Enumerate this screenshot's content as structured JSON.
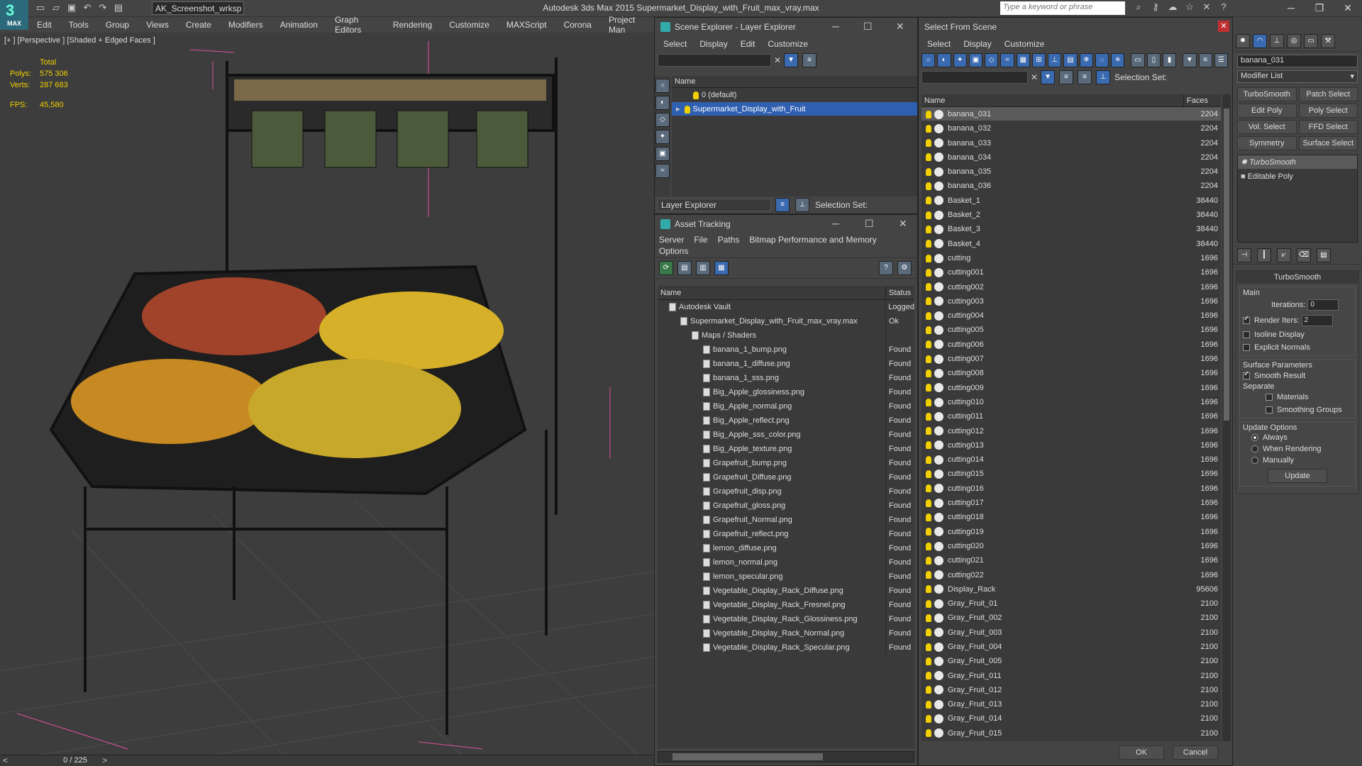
{
  "app": {
    "title": "Autodesk 3ds Max  2015     Supermarket_Display_with_Fruit_max_vray.max",
    "workspace": "AK_Screenshot_wrksp",
    "search_placeholder": "Type a keyword or phrase",
    "logo_text": "MAX"
  },
  "menu": [
    "Edit",
    "Tools",
    "Group",
    "Views",
    "Create",
    "Modifiers",
    "Animation",
    "Graph Editors",
    "Rendering",
    "Customize",
    "MAXScript",
    "Corona",
    "Project Man"
  ],
  "viewport": {
    "label": "[+ ] [Perspective ] [Shaded + Edged Faces ]",
    "stats_total": "Total",
    "polys_label": "Polys:",
    "polys": "575 306",
    "verts_label": "Verts:",
    "verts": "287 683",
    "fps_label": "FPS:",
    "fps": "45,580"
  },
  "timeline": {
    "frame": "0 / 225"
  },
  "scene_explorer": {
    "title": "Scene Explorer - Layer Explorer",
    "menu": [
      "Select",
      "Display",
      "Edit",
      "Customize"
    ],
    "col_name": "Name",
    "rows": [
      "0 (default)",
      "Supermarket_Display_with_Fruit"
    ],
    "footer_mode": "Layer Explorer",
    "selection_set": "Selection Set:"
  },
  "asset_tracking": {
    "title": "Asset Tracking",
    "menu": [
      "Server",
      "File",
      "Paths",
      "Bitmap Performance and Memory"
    ],
    "menu2": "Options",
    "col_name": "Name",
    "col_status": "Status",
    "rows": [
      {
        "name": "Autodesk Vault",
        "status": "Logged",
        "indent": 1
      },
      {
        "name": "Supermarket_Display_with_Fruit_max_vray.max",
        "status": "Ok",
        "indent": 2
      },
      {
        "name": "Maps / Shaders",
        "status": "",
        "indent": 3
      },
      {
        "name": "banana_1_bump.png",
        "status": "Found",
        "indent": 4
      },
      {
        "name": "banana_1_diffuse.png",
        "status": "Found",
        "indent": 4
      },
      {
        "name": "banana_1_sss.png",
        "status": "Found",
        "indent": 4
      },
      {
        "name": "Big_Apple_glossiness.png",
        "status": "Found",
        "indent": 4
      },
      {
        "name": "Big_Apple_normal.png",
        "status": "Found",
        "indent": 4
      },
      {
        "name": "Big_Apple_reflect.png",
        "status": "Found",
        "indent": 4
      },
      {
        "name": "Big_Apple_sss_color.png",
        "status": "Found",
        "indent": 4
      },
      {
        "name": "Big_Apple_texture.png",
        "status": "Found",
        "indent": 4
      },
      {
        "name": "Grapefruit_bump.png",
        "status": "Found",
        "indent": 4
      },
      {
        "name": "Grapefruit_Diffuse.png",
        "status": "Found",
        "indent": 4
      },
      {
        "name": "Grapefruit_disp.png",
        "status": "Found",
        "indent": 4
      },
      {
        "name": "Grapefruit_gloss.png",
        "status": "Found",
        "indent": 4
      },
      {
        "name": "Grapefruit_Normal.png",
        "status": "Found",
        "indent": 4
      },
      {
        "name": "Grapefruit_reflect.png",
        "status": "Found",
        "indent": 4
      },
      {
        "name": "lemon_diffuse.png",
        "status": "Found",
        "indent": 4
      },
      {
        "name": "lemon_normal.png",
        "status": "Found",
        "indent": 4
      },
      {
        "name": "lemon_specular.png",
        "status": "Found",
        "indent": 4
      },
      {
        "name": "Vegetable_Display_Rack_Diffuse.png",
        "status": "Found",
        "indent": 4
      },
      {
        "name": "Vegetable_Display_Rack_Fresnel.png",
        "status": "Found",
        "indent": 4
      },
      {
        "name": "Vegetable_Display_Rack_Glossiness.png",
        "status": "Found",
        "indent": 4
      },
      {
        "name": "Vegetable_Display_Rack_Normal.png",
        "status": "Found",
        "indent": 4
      },
      {
        "name": "Vegetable_Display_Rack_Specular.png",
        "status": "Found",
        "indent": 4
      }
    ]
  },
  "select_from_scene": {
    "title": "Select From Scene",
    "menu": [
      "Select",
      "Display",
      "Customize"
    ],
    "selection_set": "Selection Set:",
    "col_name": "Name",
    "col_faces": "Faces",
    "ok": "OK",
    "cancel": "Cancel",
    "rows": [
      {
        "name": "banana_031",
        "faces": "2204"
      },
      {
        "name": "banana_032",
        "faces": "2204"
      },
      {
        "name": "banana_033",
        "faces": "2204"
      },
      {
        "name": "banana_034",
        "faces": "2204"
      },
      {
        "name": "banana_035",
        "faces": "2204"
      },
      {
        "name": "banana_036",
        "faces": "2204"
      },
      {
        "name": "Basket_1",
        "faces": "38440"
      },
      {
        "name": "Basket_2",
        "faces": "38440"
      },
      {
        "name": "Basket_3",
        "faces": "38440"
      },
      {
        "name": "Basket_4",
        "faces": "38440"
      },
      {
        "name": "cutting",
        "faces": "1696"
      },
      {
        "name": "cutting001",
        "faces": "1696"
      },
      {
        "name": "cutting002",
        "faces": "1696"
      },
      {
        "name": "cutting003",
        "faces": "1696"
      },
      {
        "name": "cutting004",
        "faces": "1696"
      },
      {
        "name": "cutting005",
        "faces": "1696"
      },
      {
        "name": "cutting006",
        "faces": "1696"
      },
      {
        "name": "cutting007",
        "faces": "1696"
      },
      {
        "name": "cutting008",
        "faces": "1696"
      },
      {
        "name": "cutting009",
        "faces": "1696"
      },
      {
        "name": "cutting010",
        "faces": "1696"
      },
      {
        "name": "cutting011",
        "faces": "1696"
      },
      {
        "name": "cutting012",
        "faces": "1696"
      },
      {
        "name": "cutting013",
        "faces": "1696"
      },
      {
        "name": "cutting014",
        "faces": "1696"
      },
      {
        "name": "cutting015",
        "faces": "1696"
      },
      {
        "name": "cutting016",
        "faces": "1696"
      },
      {
        "name": "cutting017",
        "faces": "1696"
      },
      {
        "name": "cutting018",
        "faces": "1696"
      },
      {
        "name": "cutting019",
        "faces": "1696"
      },
      {
        "name": "cutting020",
        "faces": "1696"
      },
      {
        "name": "cutting021",
        "faces": "1696"
      },
      {
        "name": "cutting022",
        "faces": "1696"
      },
      {
        "name": "Display_Rack",
        "faces": "95606"
      },
      {
        "name": "Gray_Fruit_01",
        "faces": "2100"
      },
      {
        "name": "Gray_Fruit_002",
        "faces": "2100"
      },
      {
        "name": "Gray_Fruit_003",
        "faces": "2100"
      },
      {
        "name": "Gray_Fruit_004",
        "faces": "2100"
      },
      {
        "name": "Gray_Fruit_005",
        "faces": "2100"
      },
      {
        "name": "Gray_Fruit_011",
        "faces": "2100"
      },
      {
        "name": "Gray_Fruit_012",
        "faces": "2100"
      },
      {
        "name": "Gray_Fruit_013",
        "faces": "2100"
      },
      {
        "name": "Gray_Fruit_014",
        "faces": "2100"
      },
      {
        "name": "Gray_Fruit_015",
        "faces": "2100"
      }
    ]
  },
  "command_panel": {
    "object_name": "banana_031",
    "modifier_list": "Modifier List",
    "buttons": [
      "TurboSmooth",
      "Patch Select",
      "Edit Poly",
      "Poly Select",
      "Vol. Select",
      "FFD Select",
      "Symmetry",
      "Surface Select"
    ],
    "stack": [
      "TurboSmooth",
      "Editable Poly"
    ],
    "rollout_title": "TurboSmooth",
    "main_label": "Main",
    "iterations_label": "Iterations:",
    "iterations": "0",
    "render_iters_label": "Render Iters:",
    "render_iters": "2",
    "isoline": "Isoline Display",
    "explicit": "Explicit Normals",
    "surface_params": "Surface Parameters",
    "smooth_result": "Smooth Result",
    "separate": "Separate",
    "materials": "Materials",
    "smoothing_groups": "Smoothing Groups",
    "update_options": "Update Options",
    "always": "Always",
    "when_rendering": "When Rendering",
    "manually": "Manually",
    "update": "Update"
  },
  "colors": {
    "selection": "#2f5fb0",
    "stats": "#f0d000",
    "accent": "#3aa0c0"
  }
}
